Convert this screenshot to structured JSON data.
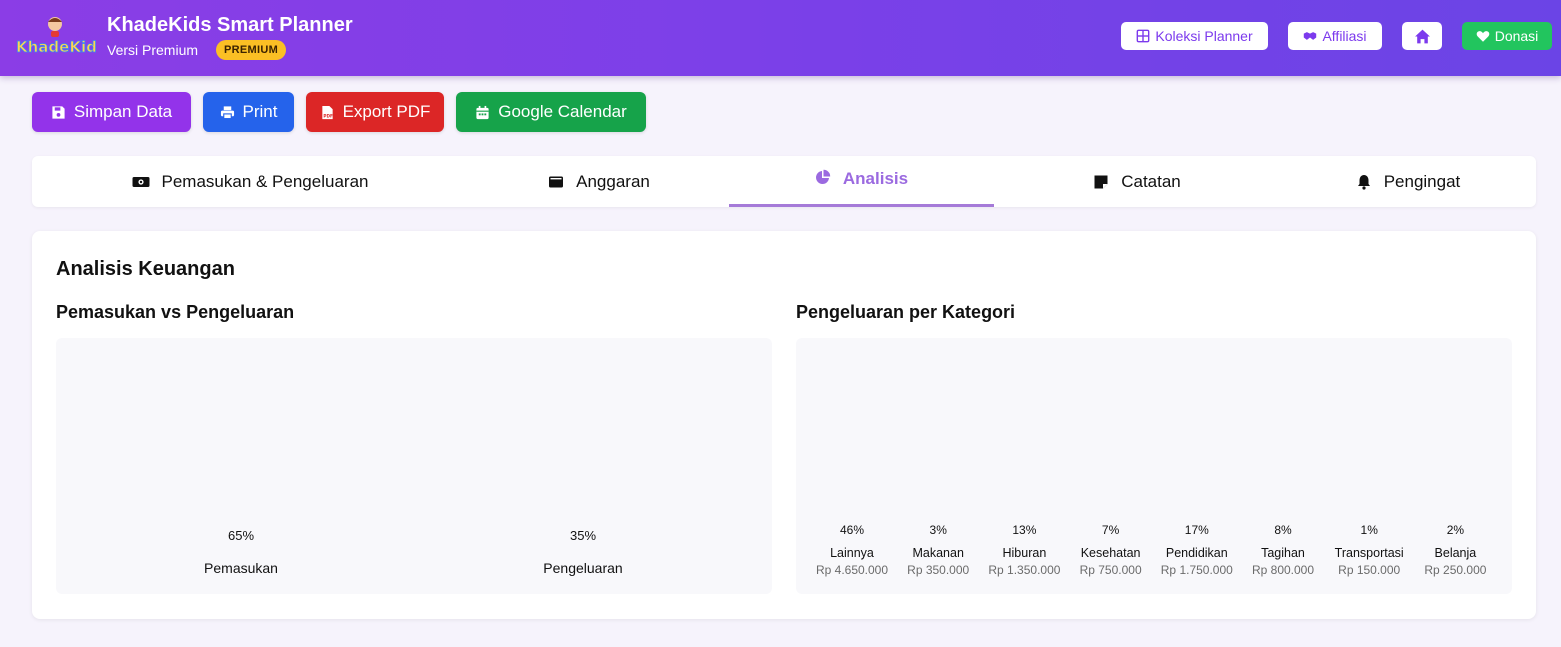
{
  "header": {
    "app_title": "KhadeKids Smart Planner",
    "subtitle": "Versi Premium",
    "badge": "PREMIUM",
    "logo_text": "KhadeKids",
    "buttons": {
      "koleksi": "Koleksi Planner",
      "affiliasi": "Affiliasi",
      "donasi": "Donasi"
    }
  },
  "actions": {
    "simpan": "Simpan Data",
    "print": "Print",
    "pdf": "Export PDF",
    "gcal": "Google Calendar"
  },
  "tabs": [
    {
      "label": "Pemasukan & Pengeluaran",
      "icon": "money-icon",
      "active": false
    },
    {
      "label": "Anggaran",
      "icon": "wallet-icon",
      "active": false
    },
    {
      "label": "Analisis",
      "icon": "pie-chart-icon",
      "active": true
    },
    {
      "label": "Catatan",
      "icon": "note-icon",
      "active": false
    },
    {
      "label": "Pengingat",
      "icon": "bell-icon",
      "active": false
    }
  ],
  "analysis": {
    "title": "Analisis Keuangan",
    "left_title": "Pemasukan vs Pengeluaran",
    "right_title": "Pengeluaran per Kategori"
  },
  "chart_data": [
    {
      "type": "bar",
      "title": "Pemasukan vs Pengeluaran",
      "categories": [
        "Pemasukan",
        "Pengeluaran"
      ],
      "values": [
        65,
        35
      ],
      "value_labels": [
        "65%",
        "35%"
      ]
    },
    {
      "type": "bar",
      "title": "Pengeluaran per Kategori",
      "categories": [
        "Lainnya",
        "Makanan",
        "Hiburan",
        "Kesehatan",
        "Pendidikan",
        "Tagihan",
        "Transportasi",
        "Belanja"
      ],
      "values": [
        46,
        3,
        13,
        7,
        17,
        8,
        1,
        2
      ],
      "value_labels": [
        "46%",
        "3%",
        "13%",
        "7%",
        "17%",
        "8%",
        "1%",
        "2%"
      ],
      "amounts": [
        "Rp 4.650.000",
        "Rp 350.000",
        "Rp 1.350.000",
        "Rp 750.000",
        "Rp 1.750.000",
        "Rp 800.000",
        "Rp 150.000",
        "Rp 250.000"
      ]
    }
  ],
  "colors": {
    "header_gradient_start": "#8b3de6",
    "header_gradient_end": "#6b44e6",
    "premium_badge": "#fbbf24",
    "simpan": "#9333ea",
    "print": "#2563eb",
    "pdf": "#dc2626",
    "gcal": "#16a34a",
    "donasi": "#22c55e",
    "active_tab": "#9b6ae0"
  }
}
